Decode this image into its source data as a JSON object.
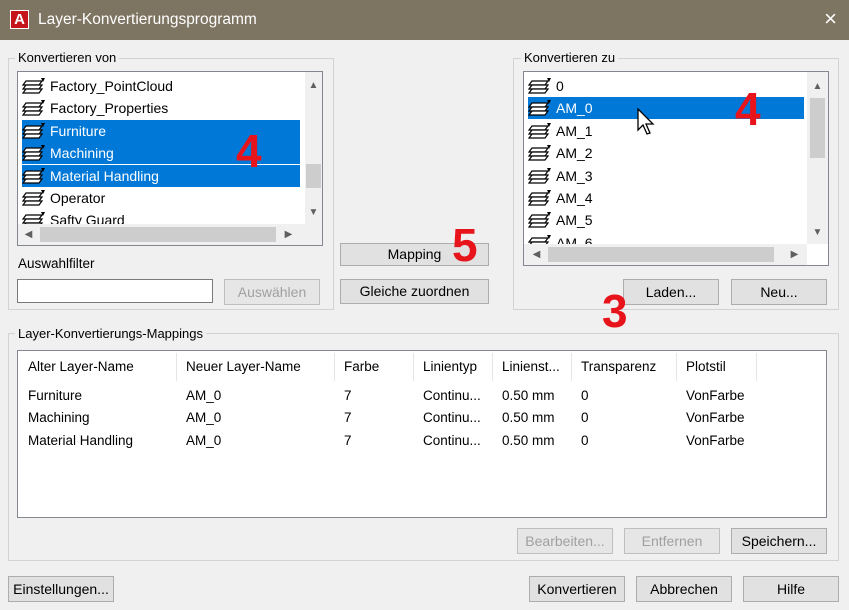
{
  "window": {
    "title": "Layer-Konvertierungsprogramm",
    "app_icon_letter": "A",
    "close_glyph": "×"
  },
  "convert_from": {
    "label": "Konvertieren von",
    "items": [
      {
        "label": "Factory_PointCloud",
        "selected": false
      },
      {
        "label": "Factory_Properties",
        "selected": false
      },
      {
        "label": "Furniture",
        "selected": true
      },
      {
        "label": "Machining",
        "selected": true
      },
      {
        "label": "Material Handling",
        "selected": true
      },
      {
        "label": "Operator",
        "selected": false
      },
      {
        "label": "Safty Guard",
        "selected": false
      }
    ]
  },
  "convert_to": {
    "label": "Konvertieren zu",
    "items": [
      {
        "label": "0",
        "selected": false
      },
      {
        "label": "AM_0",
        "selected": true
      },
      {
        "label": "AM_1",
        "selected": false
      },
      {
        "label": "AM_2",
        "selected": false
      },
      {
        "label": "AM_3",
        "selected": false
      },
      {
        "label": "AM_4",
        "selected": false
      },
      {
        "label": "AM_5",
        "selected": false
      },
      {
        "label": "AM_6",
        "selected": false
      }
    ],
    "load_button": "Laden...",
    "new_button": "Neu..."
  },
  "filter": {
    "label": "Auswahlfilter",
    "value": "",
    "select_button": "Auswählen"
  },
  "middle": {
    "mapping_button": "Mapping",
    "map_same_button": "Gleiche zuordnen"
  },
  "mappings": {
    "label": "Layer-Konvertierungs-Mappings",
    "columns": [
      "Alter Layer-Name",
      "Neuer Layer-Name",
      "Farbe",
      "Linientyp",
      "Linienst...",
      "Transparenz",
      "Plotstil"
    ],
    "rows": [
      [
        "Furniture",
        "AM_0",
        "7",
        "Continu...",
        "0.50 mm",
        "0",
        "VonFarbe"
      ],
      [
        "Machining",
        "AM_0",
        "7",
        "Continu...",
        "0.50 mm",
        "0",
        "VonFarbe"
      ],
      [
        "Material Handling",
        "AM_0",
        "7",
        "Continu...",
        "0.50 mm",
        "0",
        "VonFarbe"
      ]
    ],
    "edit_button": "Bearbeiten...",
    "remove_button": "Entfernen",
    "save_button": "Speichern..."
  },
  "footer": {
    "settings_button": "Einstellungen...",
    "convert_button": "Konvertieren",
    "cancel_button": "Abbrechen",
    "help_button": "Hilfe"
  },
  "annotations": {
    "from_marker": "4",
    "to_marker": "4",
    "mapping_marker": "5",
    "load_marker": "3"
  },
  "colors": {
    "titlebar": "#7d7462",
    "selection": "#0078d7",
    "marker": "#e8141c"
  }
}
